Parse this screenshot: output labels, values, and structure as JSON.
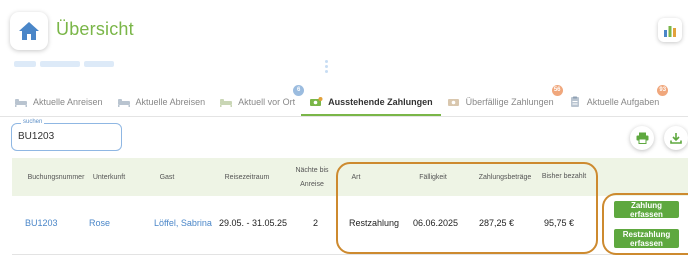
{
  "header": {
    "title": "Übersicht",
    "home_icon": "home-icon",
    "stats_icon": "bar-chart-icon"
  },
  "tabs": [
    {
      "label": "Aktuelle Anreisen",
      "icon": "bed-icon",
      "active": false,
      "badge": ""
    },
    {
      "label": "Aktuelle Abreisen",
      "icon": "bed-icon",
      "active": false,
      "badge": ""
    },
    {
      "label": "Aktuell vor Ort",
      "icon": "bed-icon",
      "active": false,
      "badge": "6"
    },
    {
      "label": "Ausstehende Zahlungen",
      "icon": "money-icon",
      "active": true,
      "badge": ""
    },
    {
      "label": "Überfällige Zahlungen",
      "icon": "money-icon",
      "active": false,
      "badge": "56"
    },
    {
      "label": "Aktuelle Aufgaben",
      "icon": "clipboard-icon",
      "active": false,
      "badge": "93"
    }
  ],
  "search": {
    "label": "suchen",
    "value": "BU1203"
  },
  "toolbar": {
    "print_icon": "print-icon",
    "download_icon": "download-icon"
  },
  "table": {
    "headers": {
      "buchungsnummer": "Buchungsnummer",
      "unterkunft": "Unterkunft",
      "gast": "Gast",
      "reisezeitraum": "Reisezeitraum",
      "naechte_line1": "Nächte bis",
      "naechte_line2": "Anreise",
      "art": "Art",
      "faelligkeit": "Fälligkeit",
      "zahlungsbetraege": "Zahlungsbeträge",
      "bisher_bezahlt": "Bisher bezahlt"
    },
    "rows": [
      {
        "buchungsnummer": "BU1203",
        "unterkunft": "Rose",
        "gast": "Löffel, Sabrina",
        "reisezeitraum": "29.05. - 31.05.25",
        "naechte": "2",
        "art": "Restzahlung",
        "faelligkeit": "06.06.2025",
        "zahlungsbetrag": "287,25 €",
        "bisher_bezahlt": "95,75 €",
        "actions": {
          "zahlung_erfassen": "Zahlung erfassen",
          "restzahlung_line1": "Restzahlung",
          "restzahlung_line2": "erfassen"
        }
      }
    ]
  },
  "colors": {
    "accent_green": "#7ab648",
    "button_green": "#5ea83f",
    "link_blue": "#4a86c8",
    "highlight_ring": "#cd8a2f",
    "header_bg": "#eef4e5"
  }
}
